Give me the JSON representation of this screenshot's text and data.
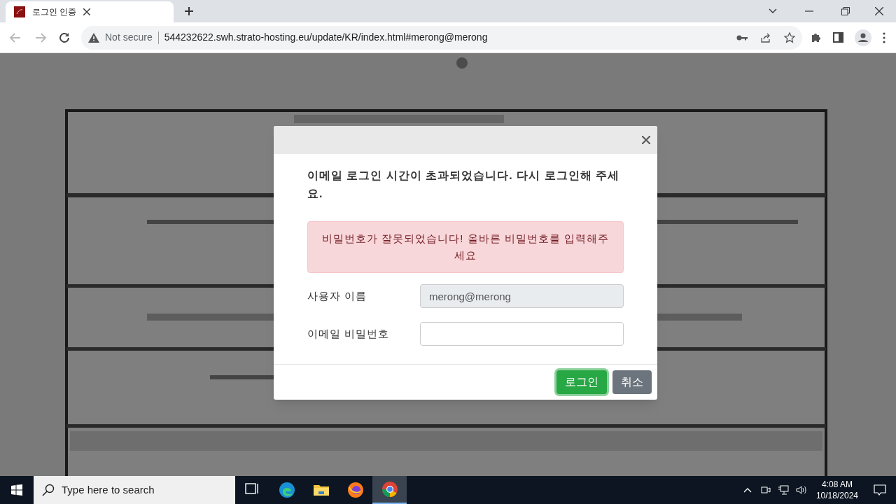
{
  "browser": {
    "tabs": [
      {
        "title": "로그인 인증",
        "selected": true
      }
    ],
    "address": {
      "security": "Not secure",
      "url": "544232622.swh.strato-hosting.eu/update/KR/index.html#merong@merong"
    }
  },
  "dialog": {
    "title": "이메일 로그인 시간이 초과되었습니다. 다시 로그인해 주세요.",
    "alert": "비밀번호가 잘못되었습니다! 올바른 비밀번호를 입력해주세요",
    "fields": [
      {
        "label": "사용자 이름",
        "value": "merong@merong",
        "disabled": true
      },
      {
        "label": "이메일 비밀번호",
        "disabled": false
      }
    ],
    "buttons": [
      {
        "label": "로그인",
        "kind": "primary"
      },
      {
        "label": "취소",
        "kind": "secondary"
      }
    ]
  },
  "taskbar": {
    "search_placeholder": "Type here to search",
    "apps": [
      {
        "kind": "taskview",
        "selected": false
      },
      {
        "kind": "edge",
        "selected": false
      },
      {
        "kind": "explorer",
        "selected": false
      },
      {
        "kind": "firefox",
        "selected": false
      },
      {
        "kind": "chrome",
        "selected": true
      }
    ],
    "time": "4:08 AM",
    "date": "10/18/2024"
  }
}
